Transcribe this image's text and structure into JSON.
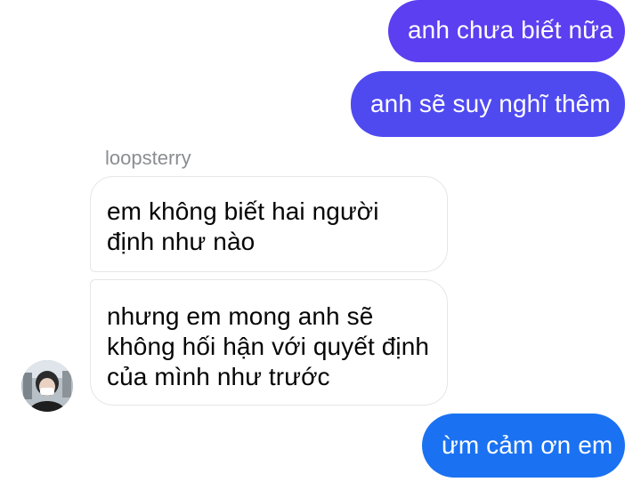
{
  "colors": {
    "outgoing_bubble_1": "#5b3ff0",
    "outgoing_bubble_2": "#4f4af0",
    "outgoing_bubble_3": "#1a72f2",
    "incoming_bubble_border": "#e6e6e6",
    "sender_name": "#8a8d91"
  },
  "messages": {
    "outgoing_1": "anh chưa biết nữa",
    "outgoing_2": "anh sẽ suy nghĩ thêm",
    "sender_name": "loopsterry",
    "incoming_1_line_1": "em không biết hai người",
    "incoming_1_line_2": "định như nào",
    "incoming_2_line_1": "nhưng em mong anh sẽ",
    "incoming_2_line_2": "không hối hận với quyết định",
    "incoming_2_line_3": "của mình như trước",
    "outgoing_3": "ừm cảm ơn em"
  },
  "avatar": {
    "icon": "profile-photo-avatar"
  }
}
